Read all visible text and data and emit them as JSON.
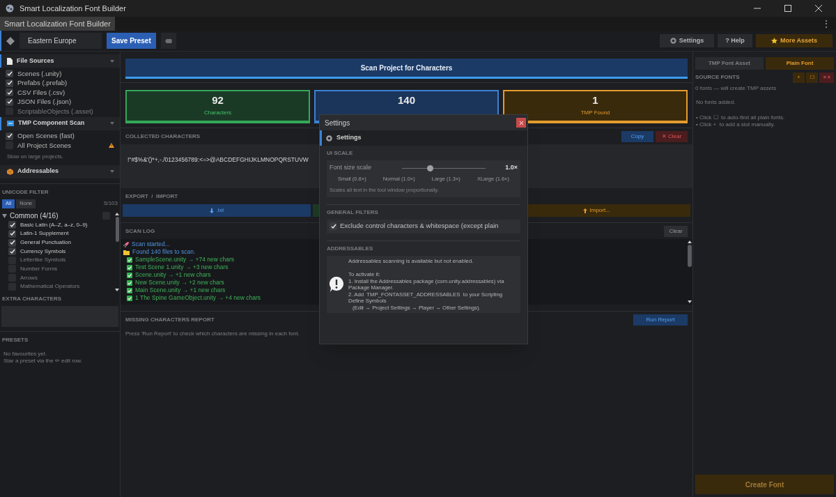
{
  "window": {
    "title": "Smart Localization Font Builder"
  },
  "tab_strip": {
    "tabs": [
      {
        "label": "Smart Localization Font Builder",
        "selected": true
      }
    ],
    "menu": "⋮"
  },
  "toolbar": {
    "preset": "Eastern Europe",
    "save_button": "Save Preset",
    "buttons": [
      {
        "label": "Settings",
        "kind": "settings"
      },
      {
        "label": "? Help",
        "kind": "plain"
      },
      {
        "label": "More Assets",
        "kind": "star"
      }
    ]
  },
  "sidebar": {
    "sections": [
      {
        "title": "File Sources",
        "kind": "file",
        "expanded": true,
        "options": [
          {
            "label": "Scenes (.unity)",
            "checked": true
          },
          {
            "label": "Prefabs (.prefab)",
            "checked": true
          },
          {
            "label": "CSV Files (.csv)",
            "checked": true
          },
          {
            "label": "JSON Files (.json)",
            "checked": true
          },
          {
            "label": "ScriptableObjects (.asset)",
            "checked": false
          }
        ]
      },
      {
        "title": "TMP Component Scan",
        "kind": "tmp",
        "expanded": true,
        "options": [
          {
            "label": "Open Scenes (fast)",
            "checked": true,
            "warning": false
          },
          {
            "label": "All Project Scenes",
            "checked": false,
            "warning": true
          }
        ],
        "note": "Slow on large projects."
      },
      {
        "title": "Addressables",
        "kind": "package",
        "expanded": false
      }
    ],
    "unicode_filter": {
      "title": "UNICODE FILTER",
      "buttons": [
        {
          "label": "All",
          "selected": true
        },
        {
          "label": "None",
          "selected": false
        }
      ],
      "count": "5/103",
      "groups": [
        {
          "label": "Common (4/16)",
          "expanded": true,
          "checked": false,
          "children": [
            {
              "label": "Basic Latin (A–Z, a–z, 0–9)",
              "checked": true
            },
            {
              "label": "Latin-1 Supplement",
              "checked": true
            },
            {
              "label": "General Punctuation",
              "checked": true
            },
            {
              "label": "Currency Symbols",
              "checked": true
            },
            {
              "label": "Letterlike Symbols",
              "checked": false
            },
            {
              "label": "Number Forms",
              "checked": false
            },
            {
              "label": "Arrows",
              "checked": false
            },
            {
              "label": "Mathematical Operators",
              "checked": false
            }
          ]
        }
      ]
    },
    "extra_characters": {
      "title": "EXTRA CHARACTERS"
    },
    "presets": {
      "title": "PRESETS",
      "notes": [
        "No favourites yet.",
        "Star a preset via the ✏ edit row."
      ]
    }
  },
  "main": {
    "scan_button": "Scan Project for Characters",
    "stats": [
      {
        "value": "92",
        "label": "Characters",
        "kind": "green"
      },
      {
        "value": "140",
        "kind": "blue"
      },
      {
        "value": "1",
        "label": "TMP Found",
        "kind": "amber"
      }
    ],
    "collected": {
      "title": "COLLECTED CHARACTERS",
      "buttons": [
        {
          "label": "Copy",
          "kind": "primary"
        },
        {
          "label": "✕ Clear",
          "kind": "danger"
        }
      ],
      "text": "!\"#$%&'()*+,-./0123456789:<=>@ABCDEFGHIJKLMNOPQRSTUVW"
    },
    "export_import": {
      "title": "EXPORT  /  IMPORT",
      "buttons": [
        {
          "label": ".txt",
          "kind": "download"
        },
        {
          "kind": "green"
        },
        {
          "label": "Import...",
          "kind": "upload"
        }
      ]
    },
    "scan_log": {
      "title": "SCAN LOG",
      "clear_button": "Clear",
      "lines": [
        {
          "text": "Scan started...",
          "kind": "start"
        },
        {
          "text": "Found 140 files to scan.",
          "kind": "folder"
        },
        {
          "text": "SampleScene.unity → +74 new chars",
          "kind": "done"
        },
        {
          "text": "Test Scene 1.unity → +3 new chars",
          "kind": "done"
        },
        {
          "text": "Scene.unity → +1 new chars",
          "kind": "done"
        },
        {
          "text": "New Scene.unity → +2 new chars",
          "kind": "done"
        },
        {
          "text": "Main Scene.unity → +1 new chars",
          "kind": "done"
        },
        {
          "text": "1 The Spine GameObject.unity → +4 new chars",
          "kind": "done"
        }
      ]
    },
    "missing_report": {
      "title": "MISSING CHARACTERS REPORT",
      "button": "Run Report",
      "hint": "Press 'Run Report' to check which characters are missing in each font."
    }
  },
  "right_panel": {
    "tabs": [
      {
        "label": "TMP Font Asset",
        "selected": false
      },
      {
        "label": "Plain Font",
        "selected": true
      }
    ],
    "title": "SOURCE FONTS",
    "buttons": [
      {
        "label": "+",
        "kind": "add"
      },
      {
        "label": "☐",
        "kind": "find"
      },
      {
        "label": "✕✕",
        "kind": "remove"
      }
    ],
    "summary": "0 fonts — will create TMP assets",
    "empty": "No fonts added.",
    "tips": [
      "• Click ☐  to auto-find all plain fonts.",
      "• Click +  to add a slot manually."
    ],
    "create_button": "Create Font"
  },
  "settings_dialog": {
    "title": "Settings",
    "header": "Settings",
    "sections": [
      {
        "title": "UI SCALE",
        "kind": "scale",
        "label": "Font size scale",
        "level": 0.34,
        "reading": "1.0×",
        "stops": [
          "Small (0.8×)",
          "Normal (1.0×)",
          "Large (1.3×)",
          "XLarge (1.6×)"
        ],
        "hint": "Scales all text in the tool window proportionally."
      },
      {
        "title": "GENERAL FILTERS",
        "kind": "filters",
        "options": [
          {
            "label": "Exclude control characters & whitespace (except plain",
            "checked": true
          }
        ]
      },
      {
        "title": "ADDRESSABLES",
        "kind": "info",
        "paragraphs": [
          "Addressables scanning is available but not enabled.",
          "To activate it:",
          "1. Install the Addressables package (com.unity.addressables) via Package Manager.",
          "2. Add  TMP_FONTASSET_ADDRESSABLES  to your Scripting Define Symbols",
          "(Edit → Project Settings → Player → Other Settings)."
        ]
      }
    ]
  }
}
